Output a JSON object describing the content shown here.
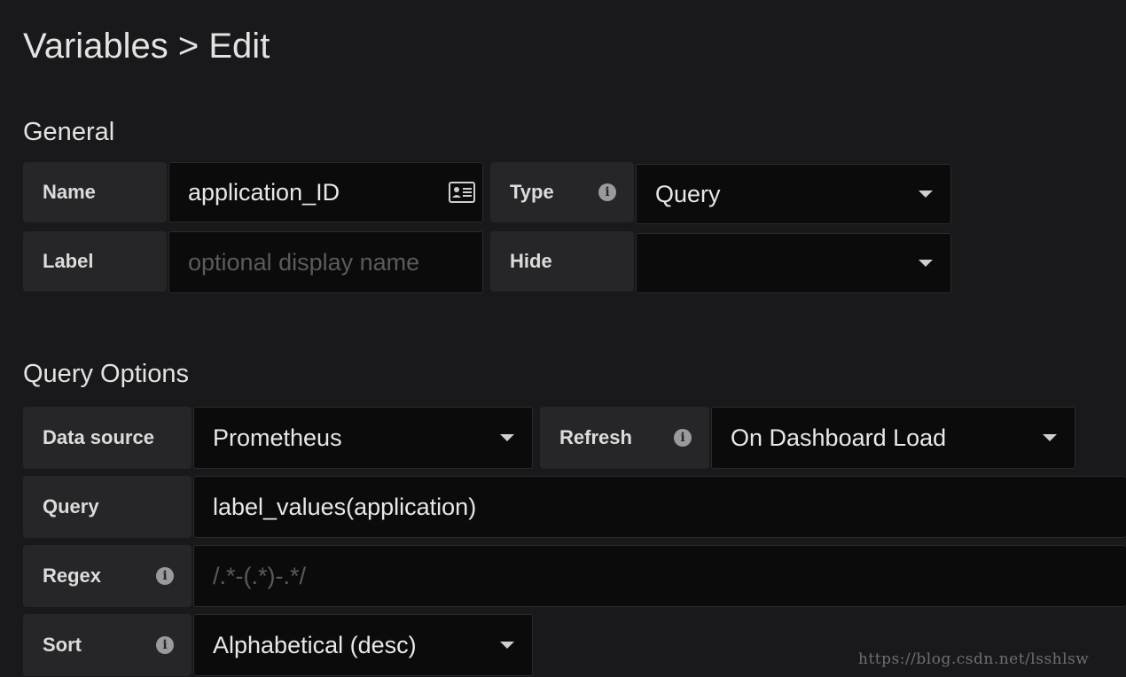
{
  "page": {
    "title": "Variables > Edit"
  },
  "general": {
    "heading": "General",
    "name_label": "Name",
    "name_value": "application_ID",
    "type_label": "Type",
    "type_value": "Query",
    "label_label": "Label",
    "label_placeholder": "optional display name",
    "hide_label": "Hide",
    "hide_value": ""
  },
  "query_options": {
    "heading": "Query Options",
    "datasource_label": "Data source",
    "datasource_value": "Prometheus",
    "refresh_label": "Refresh",
    "refresh_value": "On Dashboard Load",
    "query_label": "Query",
    "query_value": "label_values(application)",
    "regex_label": "Regex",
    "regex_placeholder": "/.*-(.*)-.*/",
    "sort_label": "Sort",
    "sort_value": "Alphabetical (desc)"
  },
  "icons": {
    "info": "info-circle-icon",
    "card": "id-card-icon",
    "dropdown": "caret-down-icon"
  },
  "watermark": "https://blog.csdn.net/lsshlsw"
}
